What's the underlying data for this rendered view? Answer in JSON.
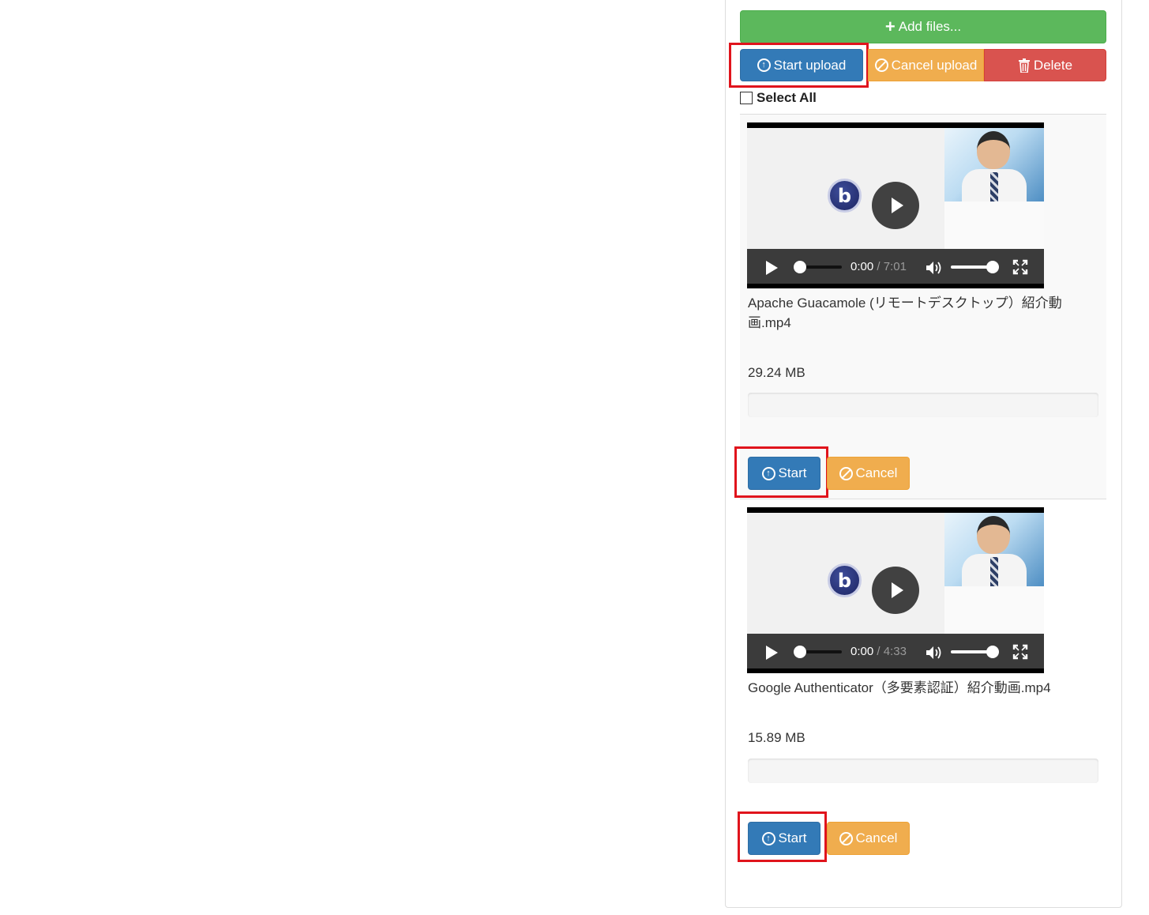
{
  "toolbar": {
    "add_files_label": "Add files...",
    "start_upload_label": "Start upload",
    "cancel_upload_label": "Cancel upload",
    "delete_label": "Delete",
    "select_all_label": "Select All"
  },
  "files": [
    {
      "name": "Apache Guacamole (リモートデスクトップ）紹介動画.mp4",
      "size": "29.24 MB",
      "video": {
        "current_time": "0:00",
        "total_time": "7:01",
        "volume": 1.0
      },
      "progress_percent": 0,
      "start_label": "Start",
      "cancel_label": "Cancel"
    },
    {
      "name": "Google Authenticator（多要素認証）紹介動画.mp4",
      "size": "15.89 MB",
      "video": {
        "current_time": "0:00",
        "total_time": "4:33",
        "volume": 1.0
      },
      "progress_percent": 0,
      "start_label": "Start",
      "cancel_label": "Cancel"
    }
  ],
  "colors": {
    "success": "#5cb85c",
    "primary": "#337ab7",
    "warning": "#f0ad4e",
    "danger": "#d9534f",
    "highlight": "#e0141c"
  },
  "icons": {
    "add": "plus-icon",
    "start": "circle-arrow-up-icon",
    "cancel": "ban-icon",
    "delete": "trash-icon"
  }
}
